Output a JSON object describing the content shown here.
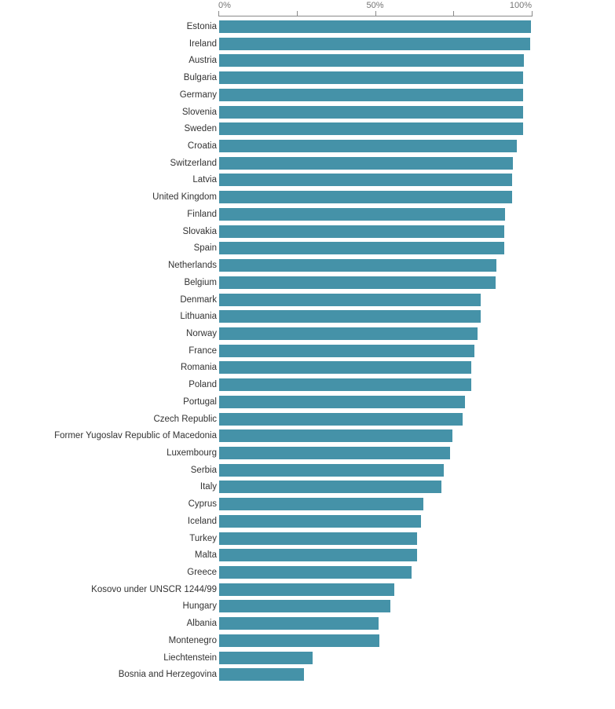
{
  "chart_data": {
    "type": "bar",
    "orientation": "horizontal",
    "title": "",
    "subtitle": "",
    "xlabel": "",
    "ylabel": "",
    "xlim": [
      0,
      100
    ],
    "grid": false,
    "legend": null,
    "bar_color": "#4592a8",
    "axis_color": "#8a8a8a",
    "label_color": "#333333",
    "tick_label_color": "#757575",
    "value_suffix": "%",
    "axis_ticks": [
      {
        "value": 0,
        "label": "0%",
        "show_label": true
      },
      {
        "value": 25,
        "label": "",
        "show_label": false
      },
      {
        "value": 50,
        "label": "50%",
        "show_label": true
      },
      {
        "value": 75,
        "label": "",
        "show_label": false
      },
      {
        "value": 100,
        "label": "100%",
        "show_label": true
      }
    ],
    "categories": [
      "Estonia",
      "Ireland",
      "Austria",
      "Bulgaria",
      "Germany",
      "Slovenia",
      "Sweden",
      "Croatia",
      "Switzerland",
      "Latvia",
      "United Kingdom",
      "Finland",
      "Slovakia",
      "Spain",
      "Netherlands",
      "Belgium",
      "Denmark",
      "Lithuania",
      "Norway",
      "France",
      "Romania",
      "Poland",
      "Portugal",
      "Czech Republic",
      "Former Yugoslav Republic of Macedonia",
      "Luxembourg",
      "Serbia",
      "Italy",
      "Cyprus",
      "Iceland",
      "Turkey",
      "Malta",
      "Greece",
      "Kosovo under UNSCR 1244/99",
      "Hungary",
      "Albania",
      "Montenegro",
      "Liechtenstein",
      "Bosnia and Herzegovina"
    ],
    "values": [
      99.8,
      99.5,
      97.5,
      97.3,
      97.3,
      97.3,
      97.2,
      95.2,
      94.0,
      93.8,
      93.8,
      91.5,
      91.3,
      91.3,
      88.8,
      88.5,
      83.8,
      83.8,
      82.8,
      81.8,
      80.8,
      80.8,
      78.8,
      78.0,
      74.7,
      73.9,
      72.0,
      71.2,
      65.4,
      64.7,
      63.4,
      63.4,
      61.7,
      56.1,
      54.9,
      51.1,
      51.4,
      30.1,
      27.3
    ]
  }
}
